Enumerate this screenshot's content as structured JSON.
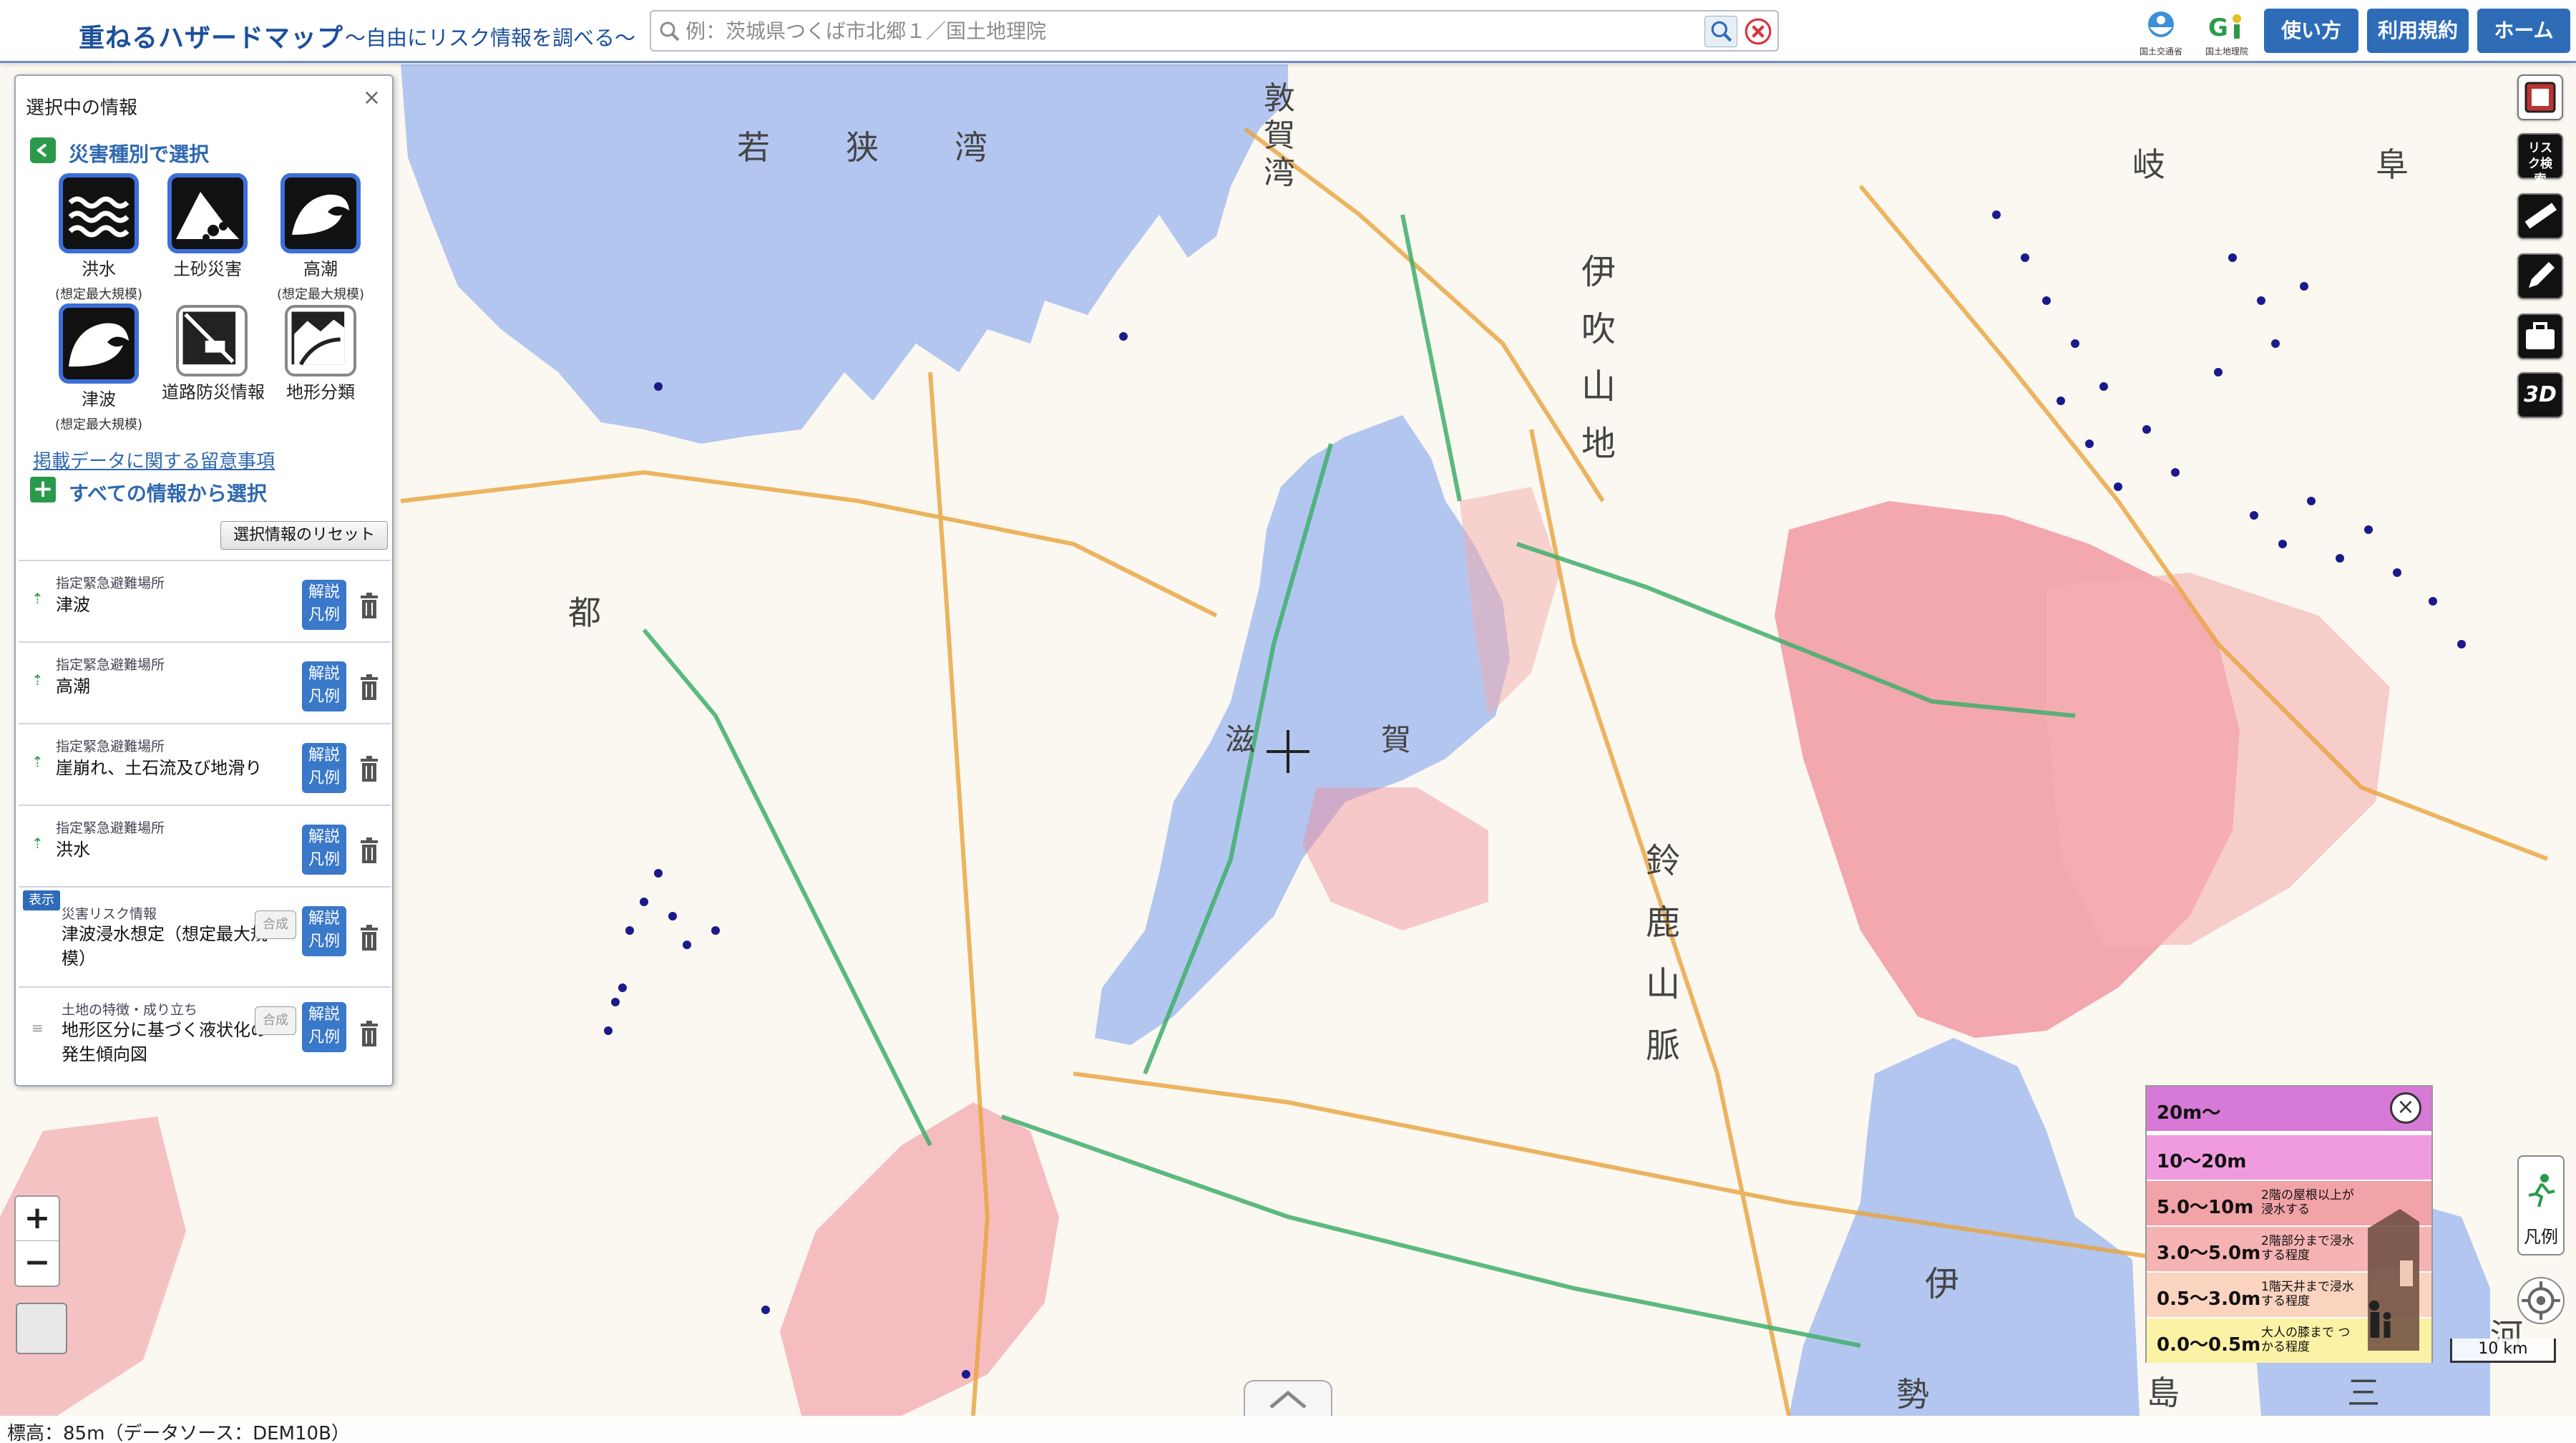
{
  "header": {
    "title": "重ねるハザードマップ",
    "subtitle": "〜自由にリスク情報を調べる〜",
    "search_placeholder": "例：茨城県つくば市北郷１／国土地理院",
    "logo1_caption": "国土交通省",
    "logo2_caption": "国土地理院",
    "buttons": [
      "使い方",
      "利用規約",
      "ホーム"
    ]
  },
  "panel": {
    "title": "選択中の情報",
    "close": "×",
    "hazard_heading": "災害種別で選択",
    "hazards": [
      {
        "label": "洪水",
        "sub": "(想定最大規模)",
        "icon": "flood-icon",
        "selected": true
      },
      {
        "label": "土砂災害",
        "sub": "",
        "icon": "landslide-icon",
        "selected": true
      },
      {
        "label": "高潮",
        "sub": "(想定最大規模)",
        "icon": "storm-surge-icon",
        "selected": true
      },
      {
        "label": "津波",
        "sub": "(想定最大規模)",
        "icon": "tsunami-icon",
        "selected": true
      },
      {
        "label": "道路防災情報",
        "sub": "",
        "icon": "road-disaster-icon",
        "selected": false
      },
      {
        "label": "地形分類",
        "sub": "",
        "icon": "landform-icon",
        "selected": false
      }
    ],
    "notice_link": "掲載データに関する留意事項",
    "all_info": "すべての情報から選択",
    "reset": "選択情報のリセット",
    "help_label_1": "解説",
    "help_label_2": "凡例",
    "gosei": "合成",
    "display_tag": "表示",
    "layers": [
      {
        "category": "指定緊急避難場所",
        "name": "津波"
      },
      {
        "category": "指定緊急避難場所",
        "name": "高潮"
      },
      {
        "category": "指定緊急避難場所",
        "name": "崖崩れ、土石流及び地滑り"
      },
      {
        "category": "指定緊急避難場所",
        "name": "洪水"
      },
      {
        "category": "災害リスク情報",
        "name": "津波浸水想定（想定最大規模）"
      },
      {
        "category": "土地の特徴・成り立ち",
        "name": "地形区分に基づく液状化の発生傾向図"
      }
    ]
  },
  "map": {
    "labels": [
      "若　狭　湾",
      "敦\n賀\n湾",
      "伊\n吹\n山\n地",
      "滋",
      "賀",
      "鈴\n鹿\n山\n脈",
      "伊",
      "岐",
      "阜",
      "都",
      "島",
      "勢",
      "三",
      "河"
    ],
    "colors": {
      "water": "#b3c6f0",
      "land": "#fbf8f1",
      "inundation": "#f08c98",
      "road": "#e8a33c",
      "rail": "#3fae6b",
      "evac": "#1a1a8a"
    }
  },
  "legend": {
    "close": "×",
    "rows": [
      {
        "value": "20m〜",
        "desc": "",
        "color": "#d779d6"
      },
      {
        "value": "10〜20m",
        "desc": "",
        "color": "#f09be0"
      },
      {
        "value": "5.0〜10m",
        "desc": "2階の屋根以上が浸水する",
        "color": "#f2a3a8"
      },
      {
        "value": "3.0〜5.0m",
        "desc": "2階部分まで浸水する程度",
        "color": "#f6b3b3"
      },
      {
        "value": "0.5〜3.0m",
        "desc": "1階天井まで浸水する程度",
        "color": "#fbd4c0"
      },
      {
        "value": "0.0〜0.5m",
        "desc": "大人の膝まで つかる程度",
        "color": "#fbf2a6"
      }
    ]
  },
  "tools": {
    "risk_search": "リスク検索",
    "three_d": "3D",
    "legend_btn": "凡例"
  },
  "scale": "10 km",
  "footer": {
    "elevation": "標高：85m（データソース：DEM10B）"
  },
  "zoom": {
    "in": "+",
    "out": "−"
  }
}
